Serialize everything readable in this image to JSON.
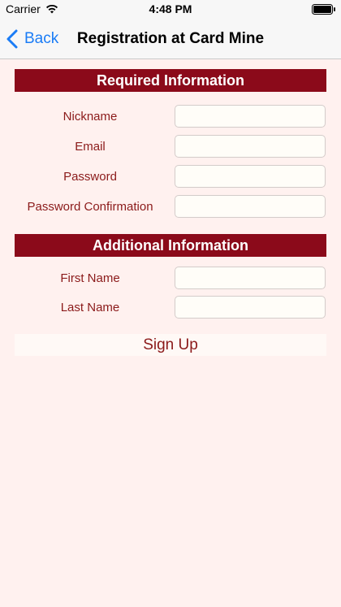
{
  "status_bar": {
    "carrier": "Carrier",
    "time": "4:48 PM",
    "wifi_icon": "wifi-icon",
    "battery_icon": "battery-icon"
  },
  "nav": {
    "back_label": "Back",
    "title": "Registration at Card Mine",
    "back_icon": "chevron-left-icon",
    "accent_color": "#1a7cf6"
  },
  "required_section": {
    "header": "Required Information",
    "fields": [
      {
        "label": "Nickname",
        "value": "",
        "placeholder": ""
      },
      {
        "label": "Email",
        "value": "",
        "placeholder": ""
      },
      {
        "label": "Password",
        "value": "",
        "placeholder": ""
      },
      {
        "label": "Password Confirmation",
        "value": "",
        "placeholder": ""
      }
    ]
  },
  "additional_section": {
    "header": "Additional Information",
    "fields": [
      {
        "label": "First Name",
        "value": "",
        "placeholder": ""
      },
      {
        "label": "Last Name",
        "value": "",
        "placeholder": ""
      }
    ]
  },
  "signup_label": "Sign Up",
  "colors": {
    "background": "#fff1ef",
    "header_background": "#8b0a1a",
    "label_text": "#8b1a1a"
  }
}
